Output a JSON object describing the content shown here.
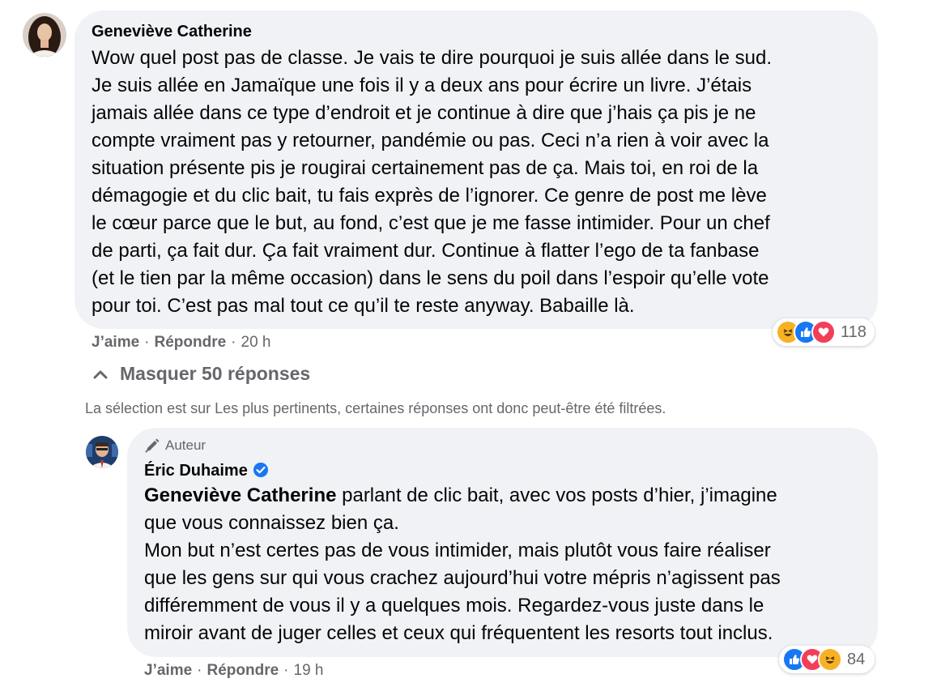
{
  "comment": {
    "author": "Geneviève Catherine",
    "text": "Wow quel post pas de classe. Je vais te dire pourquoi je suis allée dans le sud.\nJe suis allée en Jamaïque une fois il y a deux ans pour écrire un livre. J’étais\njamais allée dans ce type d’endroit et je continue à dire que j’hais ça pis je ne\ncompte vraiment pas y retourner, pandémie ou pas. Ceci n’a rien à voir avec la\nsituation présente pis je rougirai certainement pas de ça. Mais toi, en roi de la\ndémagogie et du clic bait, tu fais exprès de l’ignorer. Ce genre de post me lève\nle cœur parce que le but, au fond, c’est que je me fasse intimider. Pour un chef\nde parti, ça fait dur. Ça fait vraiment dur. Continue à flatter l’ego de ta fanbase\n(et le tien par la même occasion) dans le sens du poil dans l’espoir qu’elle vote\npour toi. C’est pas mal tout ce qu’il te reste anyway. Babaille là.",
    "like_label": "J’aime",
    "reply_label": "Répondre",
    "separator": "·",
    "time": "20 h",
    "reaction_count": "118",
    "reactions": [
      "haha-icon",
      "like-icon",
      "love-icon"
    ]
  },
  "replies_toggle": {
    "label": "Masquer 50 réponses",
    "icon": "chevron-up-icon"
  },
  "filter_note": "La sélection est sur Les plus pertinents, certaines réponses ont donc peut-être été filtrées.",
  "reply": {
    "badge": "Auteur",
    "badge_icon": "pen-icon",
    "author": "Éric Duhaime",
    "verified_icon": "verified-badge-icon",
    "mention": "Geneviève Catherine",
    "text_after_mention": " parlant de clic bait, avec vos posts d’hier, j’imagine\nque vous connaissez bien ça.\nMon but n’est certes pas de vous intimider, mais plutôt vous faire réaliser\nque les gens sur qui vous crachez aujourd’hui votre mépris n’agissent pas\ndifféremment de vous il y a quelques mois. Regardez-vous juste dans le\nmiroir avant de juger celles et ceux qui fréquentent les resorts tout inclus.",
    "like_label": "J’aime",
    "reply_label": "Répondre",
    "separator": "·",
    "time": "19 h",
    "reaction_count": "84",
    "reactions": [
      "like-icon",
      "love-icon",
      "haha-icon"
    ]
  },
  "colors": {
    "bubble": "#f0f2f5",
    "meta_text": "#65676b",
    "like_blue": "#1877f2",
    "love_red": "#f33e58",
    "haha_yellow": "#f7b125",
    "verified_blue": "#1877f2"
  }
}
